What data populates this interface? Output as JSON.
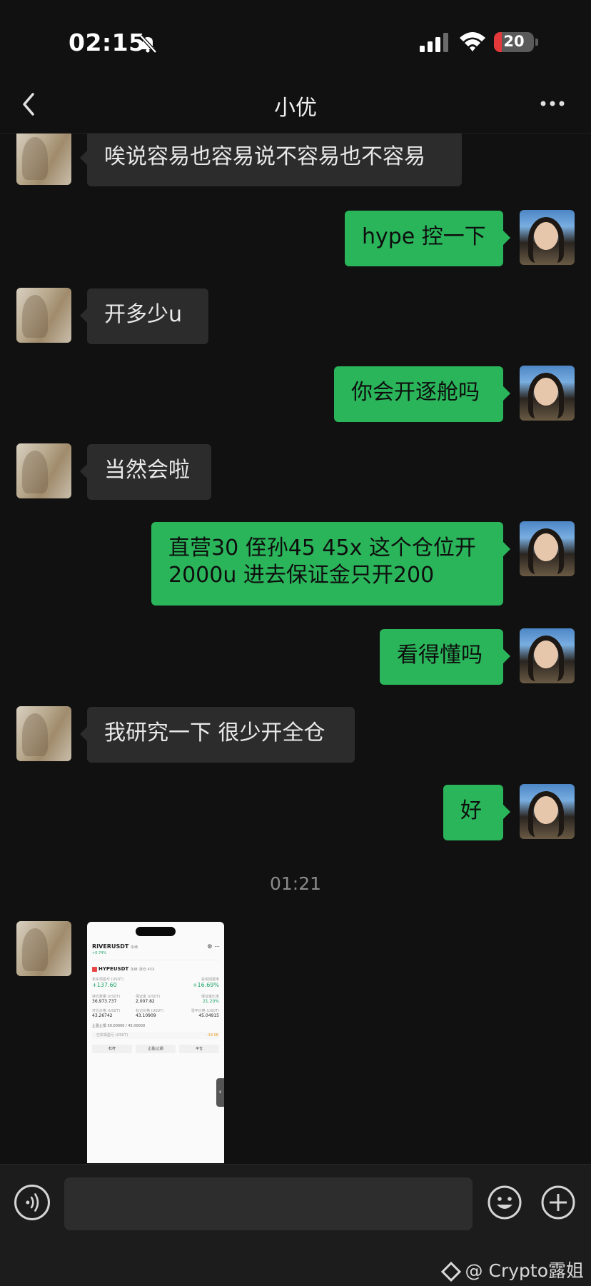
{
  "status_bar": {
    "time": "02:15",
    "battery": "20",
    "battery_level": 0.2,
    "icons": [
      "bell-slash-icon",
      "signal-icon",
      "wifi-icon",
      "battery-icon"
    ]
  },
  "nav": {
    "title": "小优",
    "back_icon": "chevron-left-icon",
    "more_icon": "more-dots-icon"
  },
  "messages": [
    {
      "side": "left",
      "text": "唉说容易也容易说不容易也不容易"
    },
    {
      "side": "right",
      "text": "hype 控一下"
    },
    {
      "side": "left",
      "text": "开多少u"
    },
    {
      "side": "right",
      "text": "你会开逐舱吗"
    },
    {
      "side": "left",
      "text": "当然会啦"
    },
    {
      "side": "right",
      "text": "直营30 侄孙45 45x 这个仓位开2000u 进去保证金只开200",
      "lines": [
        "直营30 侄孙45 45x 这个仓位开",
        "2000u 进去保证金只开200"
      ]
    },
    {
      "side": "right",
      "text": "看得懂吗"
    },
    {
      "side": "left",
      "text": "我研究一下 很少开全仓"
    },
    {
      "side": "right",
      "text": "好"
    }
  ],
  "timestamp": "01:21",
  "screenshot_message": {
    "side": "left",
    "symbol": "RIVERUSDT",
    "symbol_tag": "永续",
    "change": "+0.74%",
    "position_symbol": "HYPEUSDT",
    "position_tags": [
      "永续",
      "逐仓 45X"
    ],
    "unrealized_pnl_label": "未实现盈亏 (USDT)",
    "unrealized_pnl": "+137.60",
    "roe_label": "投资回报率",
    "roe": "+16.69%",
    "size_label": "持仓数量 (USDT)",
    "size": "36,973.737",
    "margin_label": "保证金 (USDT)",
    "margin": "2,007.82",
    "margin_ratio_label": "保证金比率",
    "margin_ratio": "21.20%",
    "entry_label": "开仓价格 (USDT)",
    "entry": "43.26742",
    "mark_label": "标记价格 (USDT)",
    "mark": "43.10909",
    "liq_label": "强平价格 (USDT)",
    "liq": "45.04915",
    "tpsl": "止盈止损 50.00000 / 45.00000",
    "tp_label": "已实现盈亏 (USDT)",
    "tp_value": "-14.06",
    "buttons": [
      "杠杆",
      "止盈/止损",
      "平仓"
    ]
  },
  "input_bar": {
    "placeholder": "",
    "voice_icon": "voice-icon",
    "emoji_icon": "emoji-icon",
    "plus_icon": "plus-icon"
  },
  "watermark": "@ Crypto露姐"
}
